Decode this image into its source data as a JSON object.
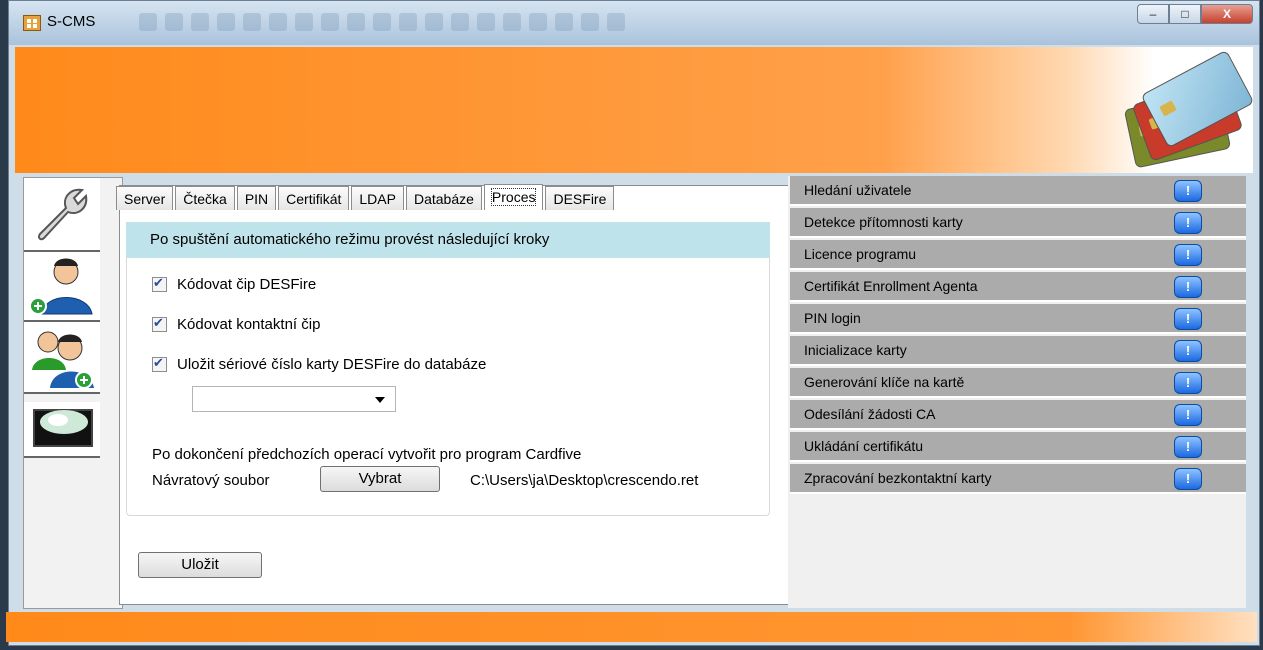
{
  "window": {
    "title": "S-CMS",
    "minimize_label": "–",
    "maximize_label": "□",
    "close_label": "X"
  },
  "tabs": [
    "Server",
    "Čtečka",
    "PIN",
    "Certifikát",
    "LDAP",
    "Databáze",
    "Proces",
    "DESFire"
  ],
  "active_tab": "Proces",
  "proces": {
    "header": "Po spuštění automatického režimu provést následující kroky",
    "checks": [
      {
        "label": "Kódovat čip DESFire",
        "checked": true
      },
      {
        "label": "Kódovat kontaktní čip",
        "checked": true
      },
      {
        "label": "Uložit sériové číslo karty DESFire do databáze",
        "checked": true
      }
    ],
    "combo_value": "",
    "after_text": "Po dokončení předchozích operací  vytvořit pro program Cardfive",
    "return_file_label": "Návratový soubor",
    "select_button": "Vybrat",
    "path": "C:\\Users\\ja\\Desktop\\crescendo.ret",
    "save_button": "Uložit"
  },
  "right_items": [
    "Hledání uživatele",
    "Detekce přítomnosti karty",
    "Licence programu",
    "Certifikát Enrollment Agenta",
    "PIN login",
    "Inicializace karty",
    "Generování klíče na kartě",
    "Odesílání žádosti CA",
    "Ukládání certifikátu",
    "Zpracování bezkontaktní karty"
  ],
  "info_glyph": "!"
}
